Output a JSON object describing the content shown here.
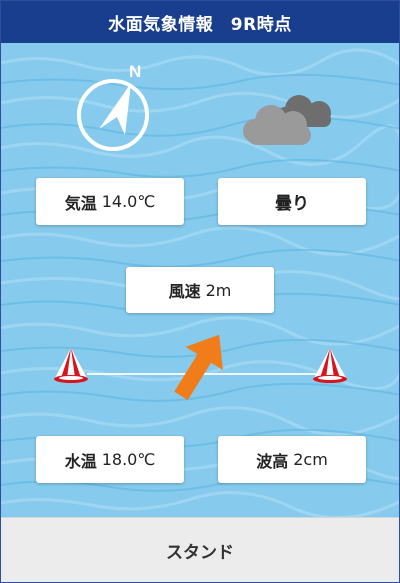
{
  "header": {
    "title": "水面気象情報　9R時点"
  },
  "compass": {
    "north_label": "N",
    "icon": "compass-icon"
  },
  "weather": {
    "icon": "cloudy-icon",
    "label": "曇り"
  },
  "air_temp": {
    "label": "気温",
    "value": "14.0℃"
  },
  "wind": {
    "label": "風速",
    "value": "2m",
    "icon": "wind-direction-arrow-icon"
  },
  "water_temp": {
    "label": "水温",
    "value": "18.0℃"
  },
  "wave": {
    "label": "波高",
    "value": "2cm"
  },
  "footer": {
    "label": "スタンド"
  },
  "colors": {
    "header": "#1a3e8e",
    "water": "#86cbee",
    "wind_arrow": "#f07d1a",
    "buoy_red": "#d8141e",
    "footer": "#ececec"
  }
}
